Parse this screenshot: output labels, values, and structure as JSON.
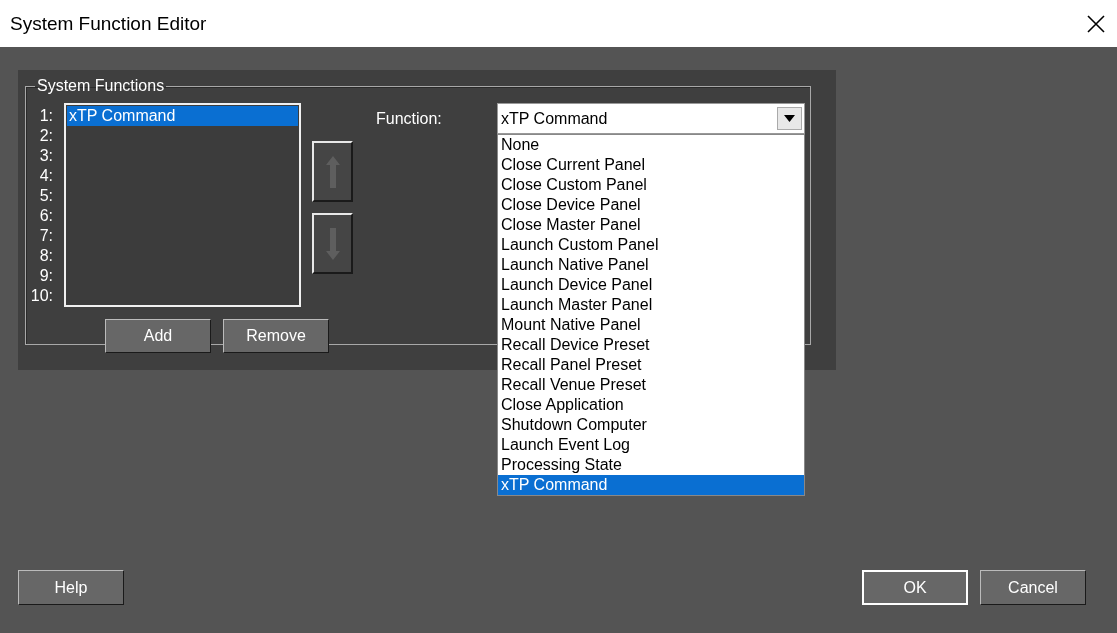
{
  "window": {
    "title": "System Function Editor"
  },
  "group": {
    "label": "System Functions"
  },
  "slots": [
    {
      "number": "1:",
      "value": "xTP Command",
      "selected": true
    },
    {
      "number": "2:",
      "selected": false
    },
    {
      "number": "3:",
      "selected": false
    },
    {
      "number": "4:",
      "selected": false
    },
    {
      "number": "5:",
      "selected": false
    },
    {
      "number": "6:",
      "selected": false
    },
    {
      "number": "7:",
      "selected": false
    },
    {
      "number": "8:",
      "selected": false
    },
    {
      "number": "9:",
      "selected": false
    },
    {
      "number": "10:",
      "selected": false
    }
  ],
  "slot_buttons": [
    "Add",
    "Remove"
  ],
  "function": {
    "label": "Function:",
    "value": "xTP Command",
    "expanded": true,
    "options": [
      {
        "label": "None",
        "selected": false
      },
      {
        "label": "Close Current Panel",
        "selected": false
      },
      {
        "label": "Close Custom Panel",
        "selected": false
      },
      {
        "label": "Close Device Panel",
        "selected": false
      },
      {
        "label": "Close Master Panel",
        "selected": false
      },
      {
        "label": "Launch Custom Panel",
        "selected": false
      },
      {
        "label": "Launch Native Panel",
        "selected": false
      },
      {
        "label": "Launch Device Panel",
        "selected": false
      },
      {
        "label": "Launch Master Panel",
        "selected": false
      },
      {
        "label": "Mount Native Panel",
        "selected": false
      },
      {
        "label": "Recall Device Preset",
        "selected": false
      },
      {
        "label": "Recall Panel Preset",
        "selected": false
      },
      {
        "label": "Recall Venue Preset",
        "selected": false
      },
      {
        "label": "Close Application",
        "selected": false
      },
      {
        "label": "Shutdown Computer",
        "selected": false
      },
      {
        "label": "Launch Event Log",
        "selected": false
      },
      {
        "label": "Processing State",
        "selected": false
      },
      {
        "label": "xTP Command",
        "selected": true
      }
    ]
  },
  "footer": {
    "left": [
      "Help"
    ],
    "right": [
      {
        "label": "OK",
        "default": true
      },
      {
        "label": "Cancel",
        "default": false
      }
    ]
  }
}
